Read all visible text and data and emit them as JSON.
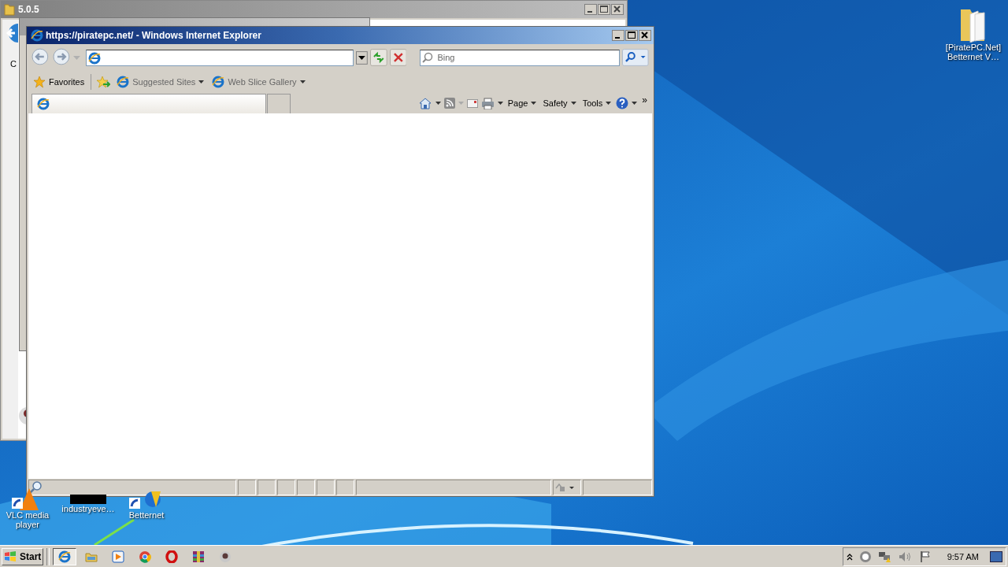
{
  "back_window": {
    "title": "5.0.5",
    "letter": "C"
  },
  "window": {
    "title": "https://piratepc.net/ - Windows Internet Explorer"
  },
  "navigation": {
    "search": {
      "placeholder": "Bing"
    }
  },
  "favorites_bar": {
    "label": "Favorites",
    "links": [
      {
        "label": "Suggested Sites"
      },
      {
        "label": "Web Slice Gallery"
      }
    ]
  },
  "command_bar": {
    "menus": [
      {
        "label": "Page"
      },
      {
        "label": "Safety"
      },
      {
        "label": "Tools"
      }
    ],
    "more": "»"
  },
  "desktop_icons": [
    {
      "kind": "folder",
      "lines": [
        "[PiratePC.Net]",
        "Betternet V…"
      ]
    },
    {
      "kind": "vlc",
      "lines": [
        "VLC media",
        "player"
      ]
    },
    {
      "kind": "blank",
      "lines": [
        "industryeve…"
      ]
    },
    {
      "kind": "shield",
      "lines": [
        "Betternet"
      ]
    }
  ],
  "taskbar": {
    "start": "Start",
    "items": [
      {
        "kind": "ie",
        "selected": true
      },
      {
        "kind": "folder",
        "selected": false
      },
      {
        "kind": "media",
        "selected": false
      },
      {
        "kind": "chrome",
        "selected": false
      },
      {
        "kind": "opera",
        "selected": false
      },
      {
        "kind": "archive",
        "selected": false
      },
      {
        "kind": "app",
        "selected": false
      }
    ],
    "clock": "9:57 AM"
  }
}
